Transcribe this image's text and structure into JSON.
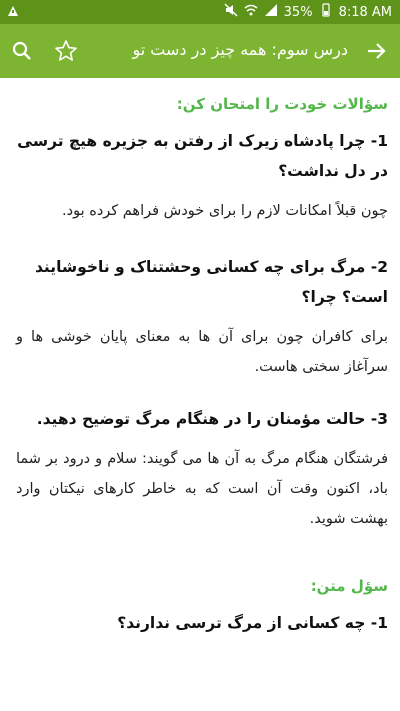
{
  "status_bar": {
    "battery": "35%",
    "time": "8:18 AM"
  },
  "toolbar": {
    "title": "درس سوم: همه چیز در دست تو"
  },
  "sections": [
    {
      "heading": "سؤالات خودت را امتحان کن:",
      "items": [
        {
          "question": "1- چرا پادشاه زیرک از رفتن به جزیره هیچ ترسی در دل نداشت؟",
          "answer": "چون قبلاً امکانات لازم را برای خودش فراهم کرده بود."
        },
        {
          "question": "2- مرگ برای چه کسانی وحشتناک و ناخوشایند است؟ چرا؟",
          "answer": "برای کافران چون برای آن ها به معنای پایان خوشی ها و سرآغاز سختی هاست."
        },
        {
          "question": "3- حالت مؤمنان را در هنگام مرگ توضیح دهید.",
          "answer": "فرشتگان هنگام مرگ به آن ها می گویند: سلام و درود بر شما باد، اکنون وقت آن است که به خاطر کارهای نیکتان وارد بهشت شوید."
        }
      ]
    },
    {
      "heading": "سؤل متن:",
      "items": [
        {
          "question": "1- چه کسانی از مرگ ترسی ندارند؟"
        }
      ]
    }
  ]
}
